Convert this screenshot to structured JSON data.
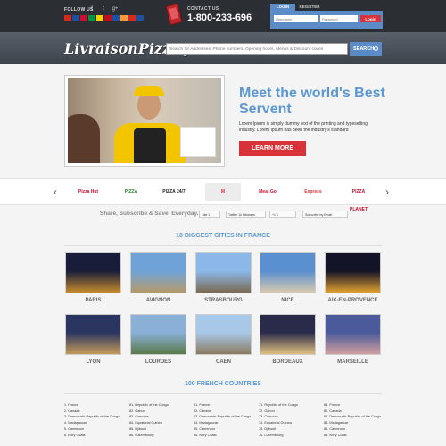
{
  "topbar": {
    "follow_label": "FOLLOW US",
    "social_icons": [
      "facebook-icon",
      "twitter-icon",
      "googleplus-icon"
    ],
    "flag_colors": [
      "#d52b1e",
      "#1e4fa0",
      "#c8102e",
      "#009246",
      "#f5d100",
      "#c60b1e",
      "#1e4fa0",
      "#ff9933",
      "#d52b1e",
      "#1e4fa0"
    ],
    "contact_label": "CONTACT US",
    "phone": "1-800-233-696",
    "login_tab": "LOGIN",
    "register_tab": "REGISTER",
    "username_placeholder": "Username",
    "password_placeholder": "Password",
    "login_button": "Login"
  },
  "header": {
    "logo": "LivraisonPizza.fr",
    "search_placeholder": "Search for Addresses, Phone numbers, Opening hours, Menus & Discount codes",
    "search_button": "SEARCH"
  },
  "hero": {
    "title": "Meet the world's Best Servent",
    "text": "Lorem Ipsum is simply dummy text of the printing and typesetting industry. Lorem Ipsum has been the industry's standard",
    "button": "LEARN MORE"
  },
  "brands": {
    "items": [
      {
        "label": "Pizza Hut",
        "color": "#c8102e"
      },
      {
        "label": "PIZZA",
        "color": "#2e7d32"
      },
      {
        "label": "PIZZA 24/7",
        "color": "#222222"
      },
      {
        "label": "M",
        "color": "#d9323a"
      },
      {
        "label": "Meat Go",
        "color": "#c8102e"
      },
      {
        "label": "Express",
        "color": "#d9323a"
      },
      {
        "label": "PIZZA PLANET",
        "color": "#c8102e"
      }
    ],
    "active_index": 3
  },
  "share": {
    "label": "Share, Subscribe & Save. Everyday.",
    "like": "Like",
    "like_count": "1",
    "twitter": "Twitter",
    "followers": "1k followers",
    "gplus": "+1",
    "gplus_count": "1",
    "subscribe": "Subscribe by Email"
  },
  "cities": {
    "title": "10 BIGGEST CITIES IN FRANCE",
    "items": [
      {
        "name": "PARIS",
        "colors": [
          "#1a1d3a",
          "#c58a2e"
        ]
      },
      {
        "name": "AVIGNON",
        "colors": [
          "#6fa3d8",
          "#b59a6a"
        ]
      },
      {
        "name": "STRASBOURG",
        "colors": [
          "#8bb8e8",
          "#7a6a52"
        ]
      },
      {
        "name": "NICE",
        "colors": [
          "#5a8fd0",
          "#d8cab0"
        ]
      },
      {
        "name": "AIX-EN-PROVENCE",
        "colors": [
          "#141428",
          "#e0a030"
        ]
      },
      {
        "name": "LYON",
        "colors": [
          "#2a3560",
          "#c49a5a"
        ]
      },
      {
        "name": "LOURDES",
        "colors": [
          "#8ab0d8",
          "#5a7a4a"
        ]
      },
      {
        "name": "CAEN",
        "colors": [
          "#a8c8e8",
          "#8a7a60"
        ]
      },
      {
        "name": "BORDEAUX",
        "colors": [
          "#2a2a4a",
          "#e0c080"
        ]
      },
      {
        "name": "MARSEILLE",
        "colors": [
          "#4a5a9a",
          "#d0a0a0"
        ]
      }
    ]
  },
  "countries": {
    "title": "100 FRENCH COUNTRIES",
    "columns": [
      [
        "1. France",
        "2. Canada",
        "3. Democratic Republic of the Congo",
        "4. Madagascar",
        "5. Cameroon",
        "6. Ivory Coast"
      ],
      [
        "81. Republic of the Congo",
        "82. Gabon",
        "83. Comoros",
        "84. Equatorial Guinea",
        "85. Djibouti",
        "86. Luxembourg"
      ],
      [
        "41. France",
        "42. Canada",
        "43. Democratic Republic of the Congo",
        "44. Madagascar",
        "45. Cameroon",
        "46. Ivory Coast"
      ],
      [
        "71. Republic of the Congo",
        "72. Gabon",
        "73. Comoros",
        "74. Equatorial Guinea",
        "75. Djibouti",
        "76. Luxembourg"
      ],
      [
        "81. France",
        "82. Canada",
        "83. Democratic Republic of the Congo",
        "84. Madagascar",
        "85. Cameroon",
        "86. Ivory Coast"
      ]
    ]
  }
}
